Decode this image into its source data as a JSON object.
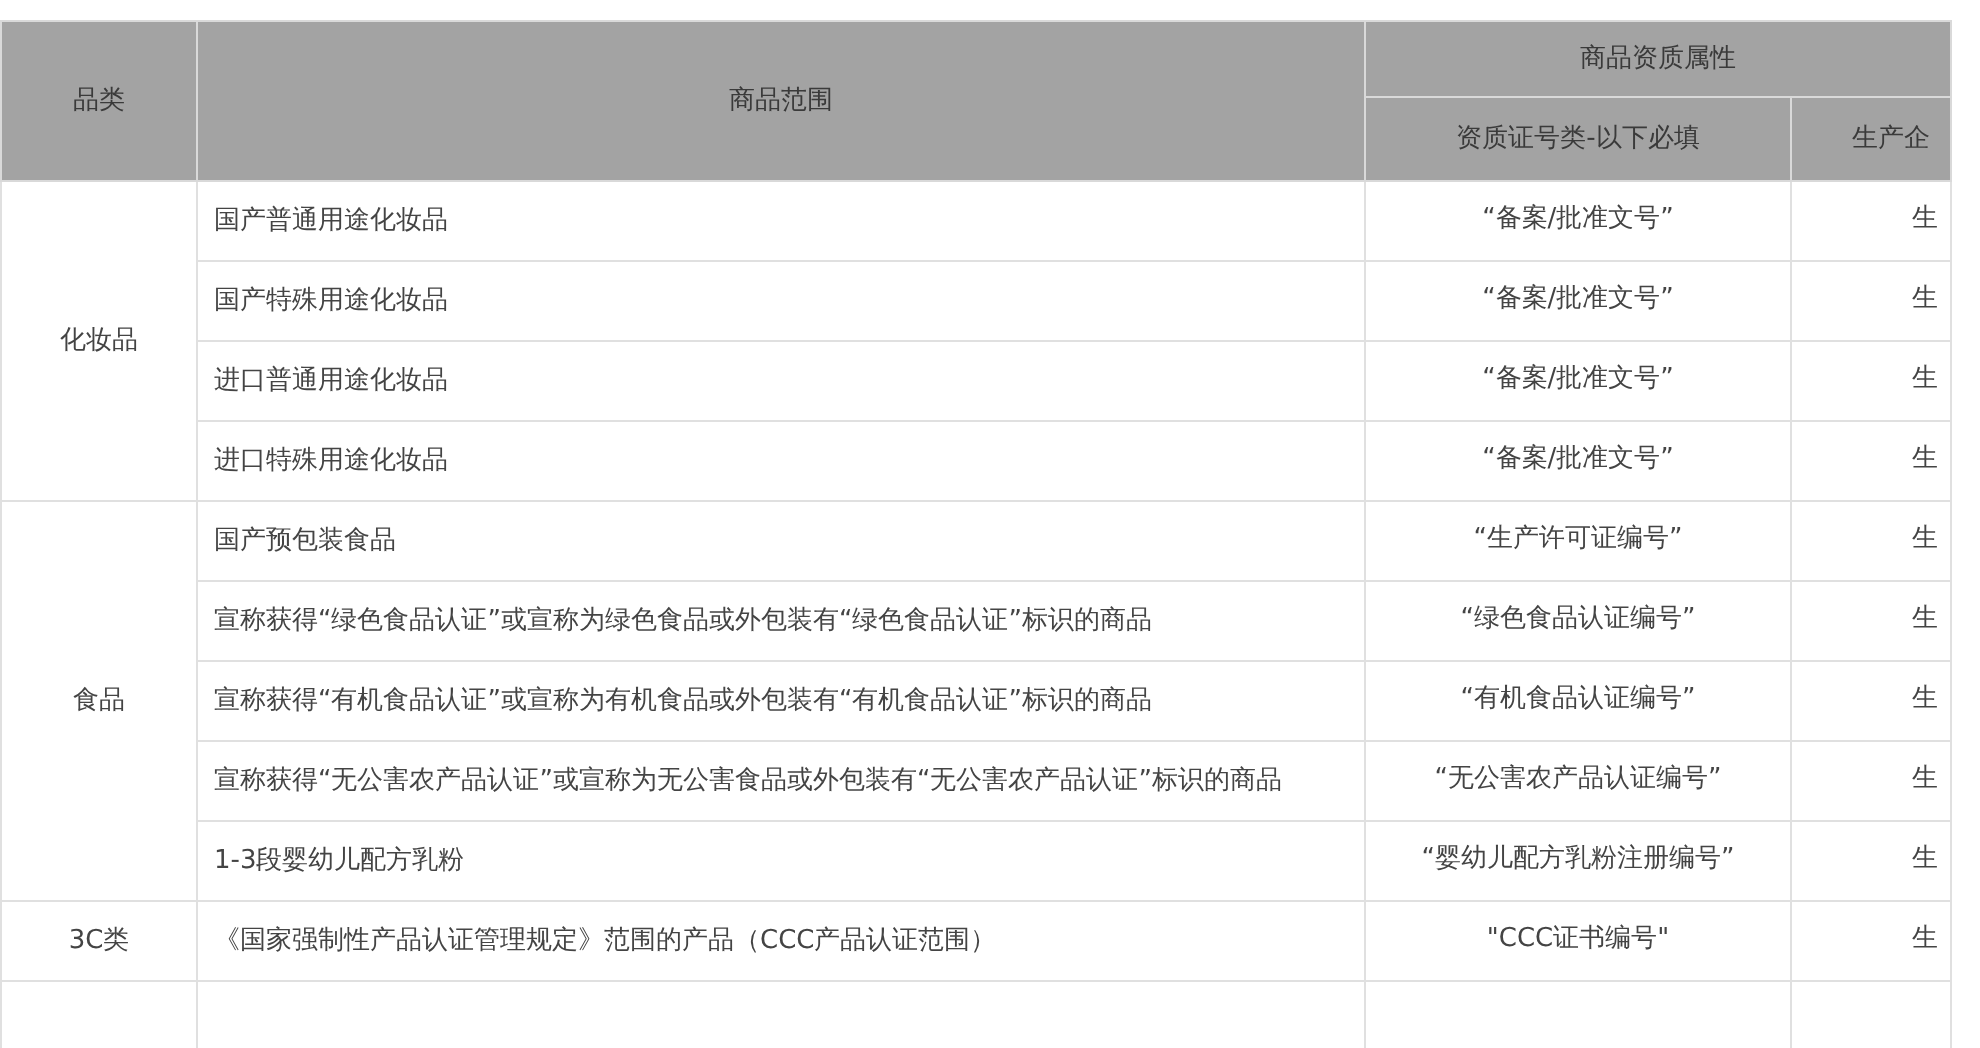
{
  "table": {
    "columns": {
      "category": "品类",
      "scope": "商品范围",
      "group": "商品资质属性",
      "qualification": "资质证号类-以下必填",
      "column_4": "生产企"
    },
    "groups": [
      {
        "category": "化妆品",
        "rows": [
          {
            "scope": "国产普通用途化妆品",
            "qualification": "“备案/批准文号”",
            "column_4": "生"
          },
          {
            "scope": "国产特殊用途化妆品",
            "qualification": "“备案/批准文号”",
            "column_4": "生"
          },
          {
            "scope": "进口普通用途化妆品",
            "qualification": "“备案/批准文号”",
            "column_4": "生"
          },
          {
            "scope": "进口特殊用途化妆品",
            "qualification": "“备案/批准文号”",
            "column_4": "生"
          }
        ]
      },
      {
        "category": "食品",
        "rows": [
          {
            "scope": "国产预包装食品",
            "qualification": "“生产许可证编号”",
            "column_4": "生"
          },
          {
            "scope": "宣称获得“绿色食品认证”或宣称为绿色食品或外包装有“绿色食品认证”标识的商品",
            "qualification": "“绿色食品认证编号”",
            "column_4": "生"
          },
          {
            "scope": "宣称获得“有机食品认证”或宣称为有机食品或外包装有“有机食品认证”标识的商品",
            "qualification": "“有机食品认证编号”",
            "column_4": "生"
          },
          {
            "scope": "宣称获得“无公害农产品认证”或宣称为无公害食品或外包装有“无公害农产品认证”标识的商品",
            "qualification": "“无公害农产品认证编号”",
            "column_4": "生"
          },
          {
            "scope": "1-3段婴幼儿配方乳粉",
            "qualification": "“婴幼儿配方乳粉注册编号”",
            "column_4": "生"
          }
        ]
      },
      {
        "category": "3C类",
        "rows": [
          {
            "scope": "《国家强制性产品认证管理规定》范围的产品（CCC产品认证范围）",
            "qualification": "\"CCC证书编号\"",
            "column_4": "生"
          }
        ]
      }
    ]
  }
}
